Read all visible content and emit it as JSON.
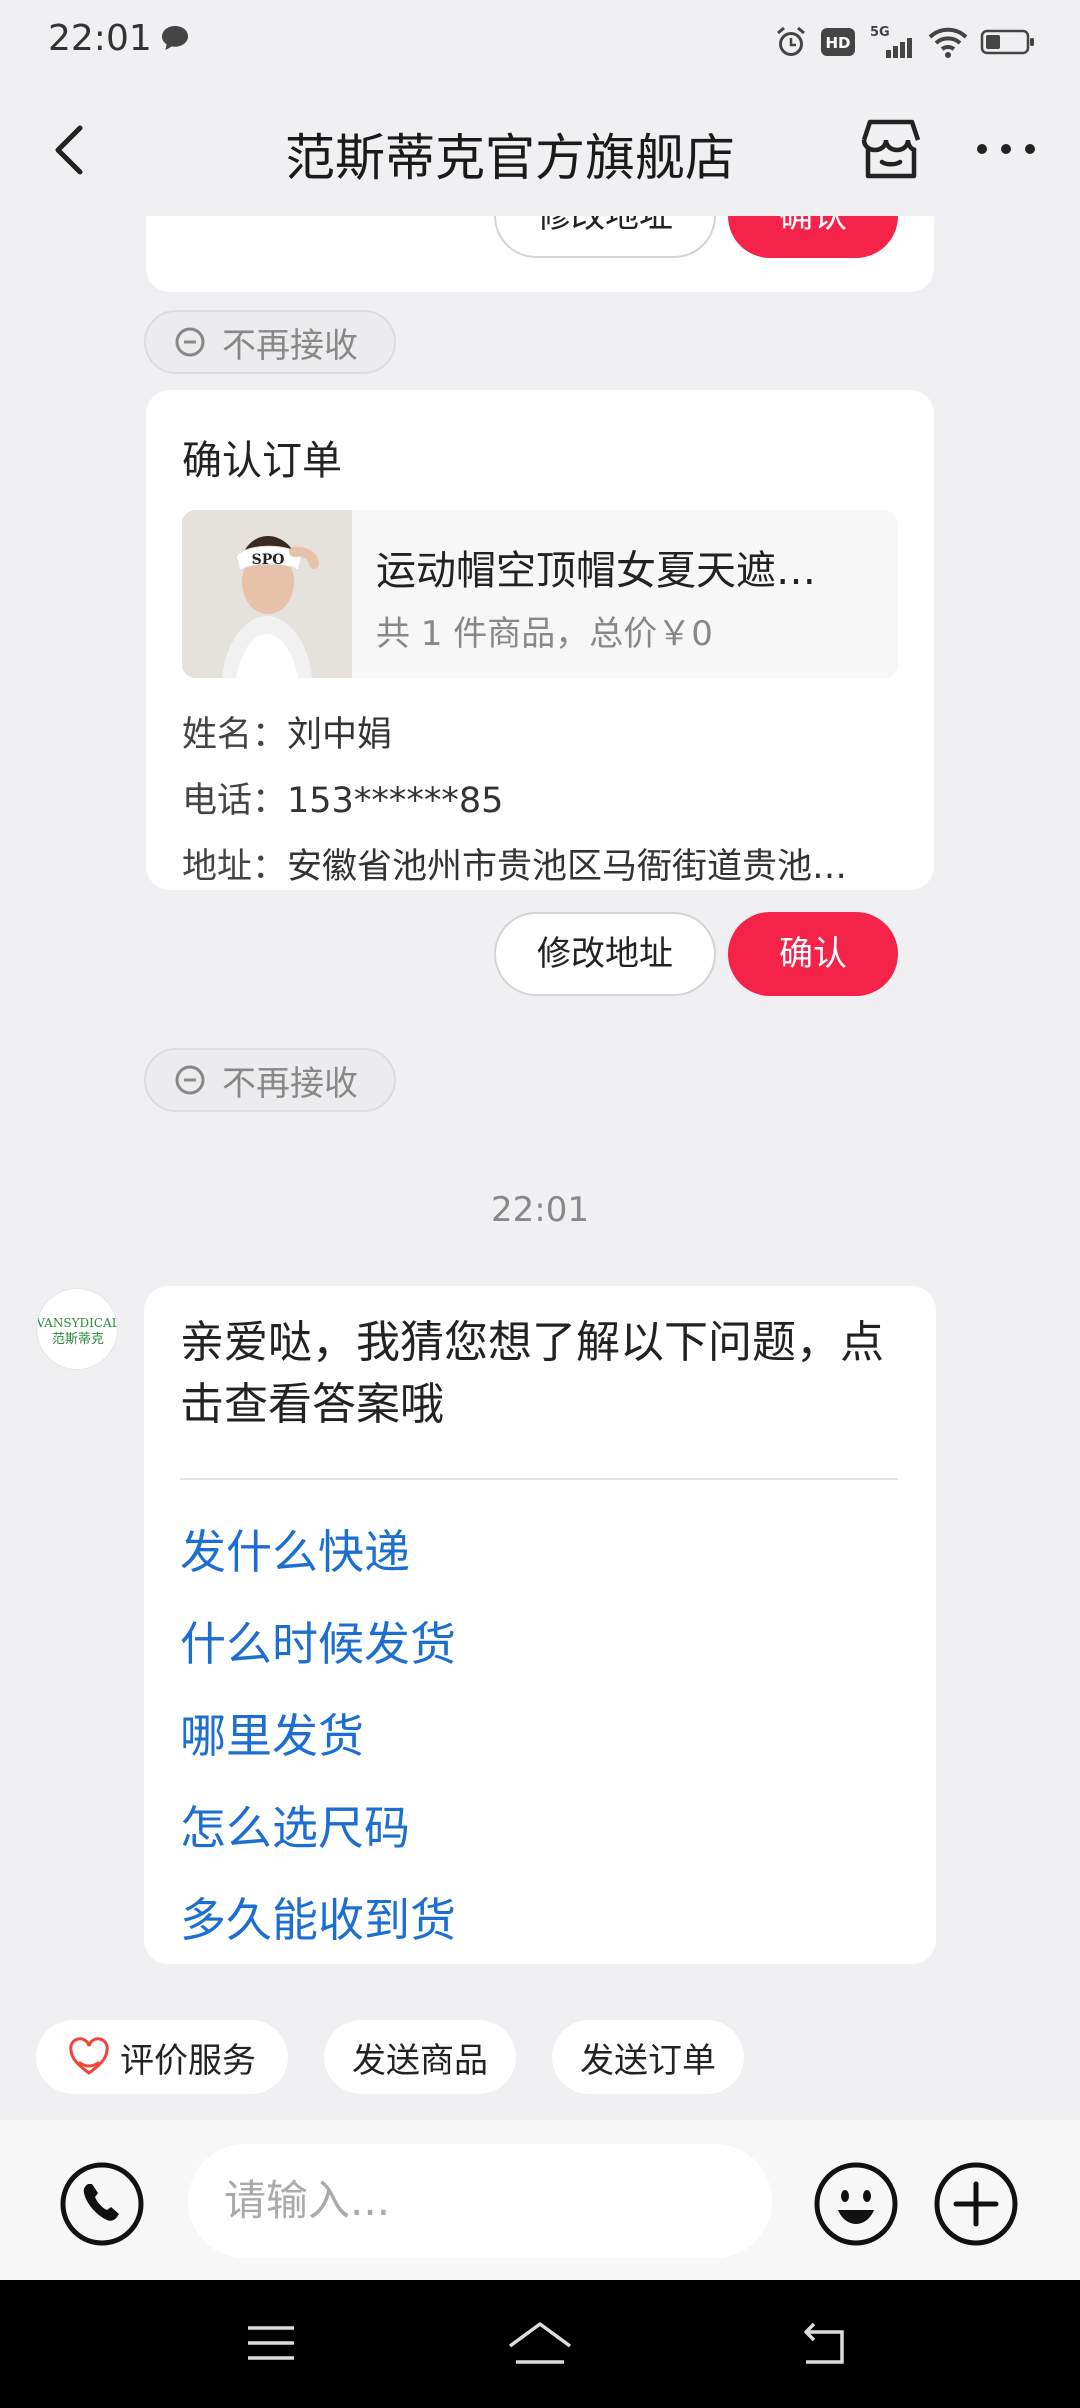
{
  "status_bar": {
    "time": "22:01",
    "network": "5G",
    "hd": "HD"
  },
  "header": {
    "title": "范斯蒂克官方旗舰店"
  },
  "order_top": {
    "modify_label": "修改地址",
    "confirm_label": "确认"
  },
  "reject_1": {
    "label": "不再接收"
  },
  "order": {
    "title": "确认订单",
    "product_name": "运动帽空顶帽女夏天遮…",
    "product_summary": "共 1 件商品，总价￥0",
    "name_label": "姓名：",
    "name_value": "刘中娟",
    "phone_label": "电话：",
    "phone_value": "153******85",
    "address_label": "地址：",
    "address_value": "安徽省池州市贵池区马衙街道贵池…",
    "modify_label": "修改地址",
    "confirm_label": "确认"
  },
  "reject_2": {
    "label": "不再接收"
  },
  "timestamp": "22:01",
  "faq": {
    "avatar_text_top": "VANSYDICAL",
    "avatar_text_bottom": "范斯蒂克",
    "intro": "亲爱哒，我猜您想了解以下问题，点击查看答案哦",
    "items": [
      "发什么快递",
      "什么时候发货",
      "哪里发货",
      "怎么选尺码",
      "多久能收到货"
    ]
  },
  "quick_actions": [
    "评价服务",
    "发送商品",
    "发送订单"
  ],
  "input": {
    "placeholder": "请输入..."
  },
  "colors": {
    "accent_red": "#f5224a",
    "link_blue": "#1c6fd1",
    "background": "#f0f0f2"
  }
}
